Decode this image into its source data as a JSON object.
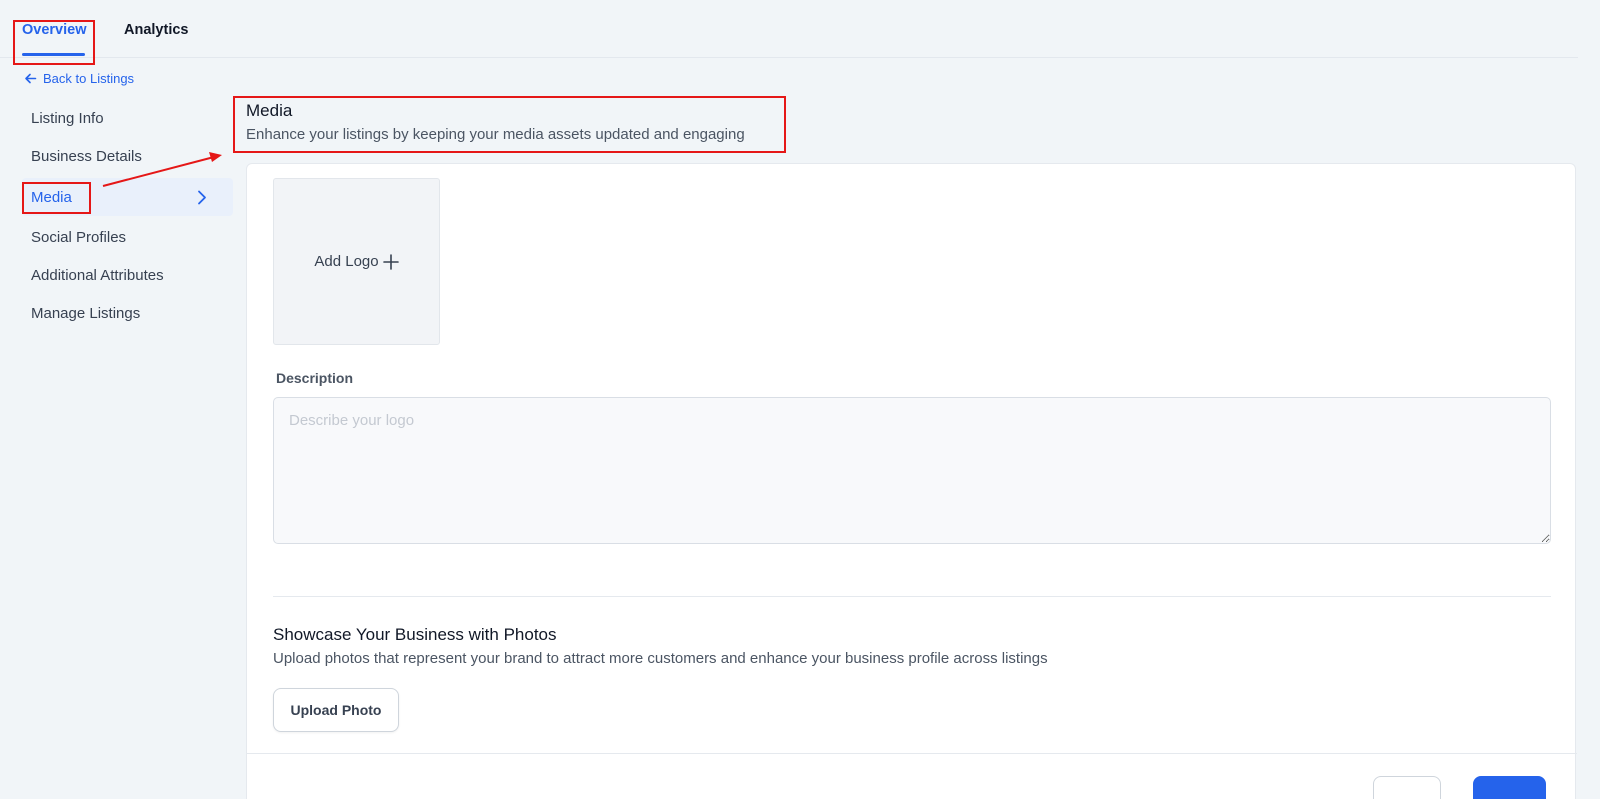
{
  "tabs": [
    {
      "label": "Overview",
      "active": true
    },
    {
      "label": "Analytics",
      "active": false
    }
  ],
  "back_link": {
    "label": "Back to Listings",
    "icon": "arrow-left-icon"
  },
  "sidebar": {
    "items": [
      {
        "label": "Listing Info",
        "active": false
      },
      {
        "label": "Business Details",
        "active": false
      },
      {
        "label": "Media",
        "active": true
      },
      {
        "label": "Social Profiles",
        "active": false
      },
      {
        "label": "Additional Attributes",
        "active": false
      },
      {
        "label": "Manage Listings",
        "active": false
      }
    ]
  },
  "header": {
    "title": "Media",
    "subtitle": "Enhance your listings by keeping your media assets updated and engaging"
  },
  "logo": {
    "label": "Add Logo",
    "icon": "plus-icon"
  },
  "description": {
    "label": "Description",
    "placeholder": "Describe your logo",
    "value": ""
  },
  "photos": {
    "title": "Showcase Your Business with Photos",
    "subtitle": "Upload photos that represent your brand to attract more customers and enhance your business profile across listings",
    "upload_label": "Upload Photo"
  },
  "colors": {
    "accent": "#2563eb",
    "annotation": "#e51717",
    "background": "#f1f5f8"
  }
}
